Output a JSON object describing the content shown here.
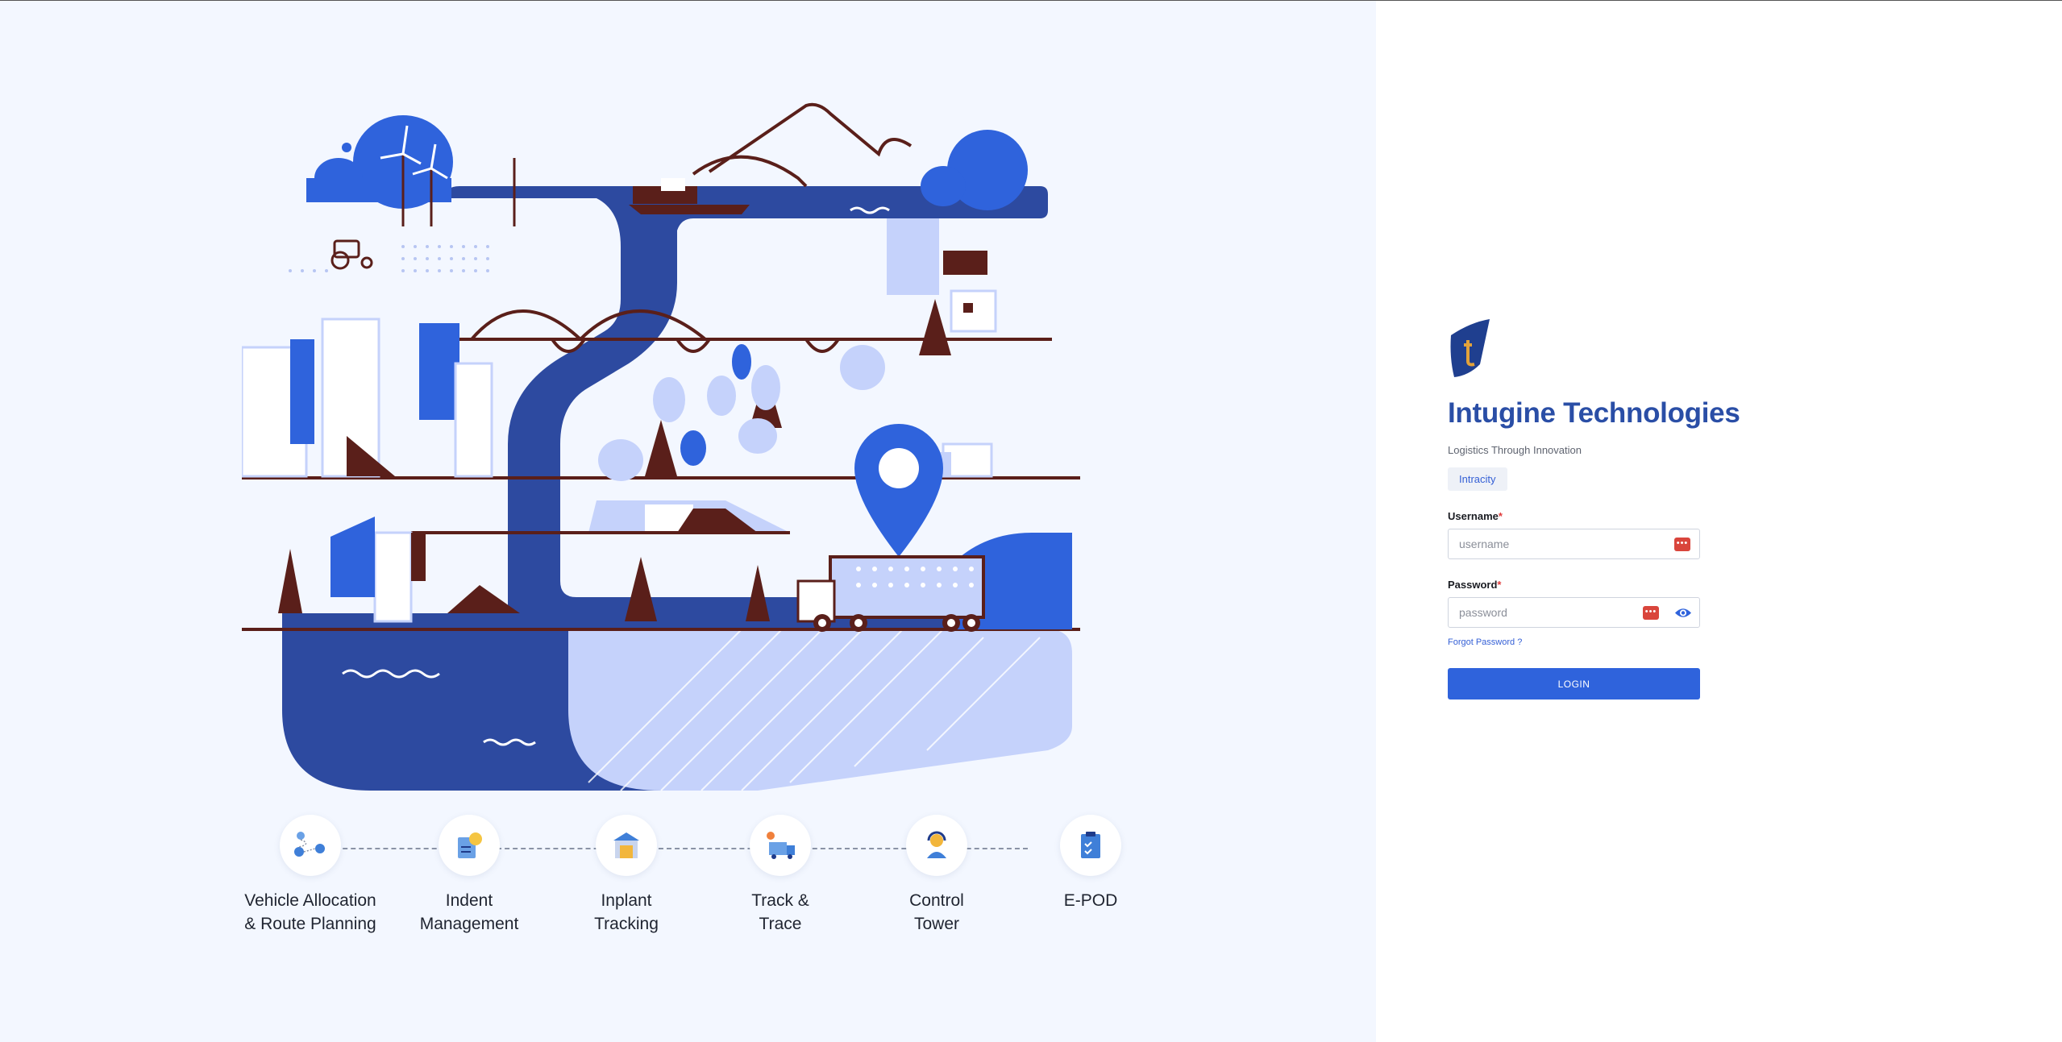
{
  "brand": {
    "company_name": "Intugine Technologies",
    "tagline": "Logistics Through Innovation",
    "product_tag": "Intracity"
  },
  "form": {
    "username_label": "Username",
    "username_placeholder": "username",
    "username_value": "",
    "password_label": "Password",
    "password_placeholder": "password",
    "password_value": "",
    "required_marker": "*",
    "forgot_password": "Forgot Password ?",
    "login_button": "LOGIN"
  },
  "features": [
    {
      "label": "Vehicle Allocation\n& Route Planning",
      "icon": "route-planning-icon"
    },
    {
      "label": "Indent\nManagement",
      "icon": "indent-icon"
    },
    {
      "label": "Inplant\nTracking",
      "icon": "warehouse-icon"
    },
    {
      "label": "Track &\nTrace",
      "icon": "truck-location-icon"
    },
    {
      "label": "Control\nTower",
      "icon": "operator-icon"
    },
    {
      "label": "E-POD",
      "icon": "clipboard-check-icon"
    }
  ],
  "colors": {
    "primary": "#2f63dc",
    "brand_text": "#2a4ea6",
    "illustration_dark_blue": "#2d4aa0",
    "illustration_light_blue": "#c5d2fb",
    "illustration_brown": "#5a1f1a",
    "required": "#e03b3b",
    "key_icon_bg": "#d9453c"
  }
}
